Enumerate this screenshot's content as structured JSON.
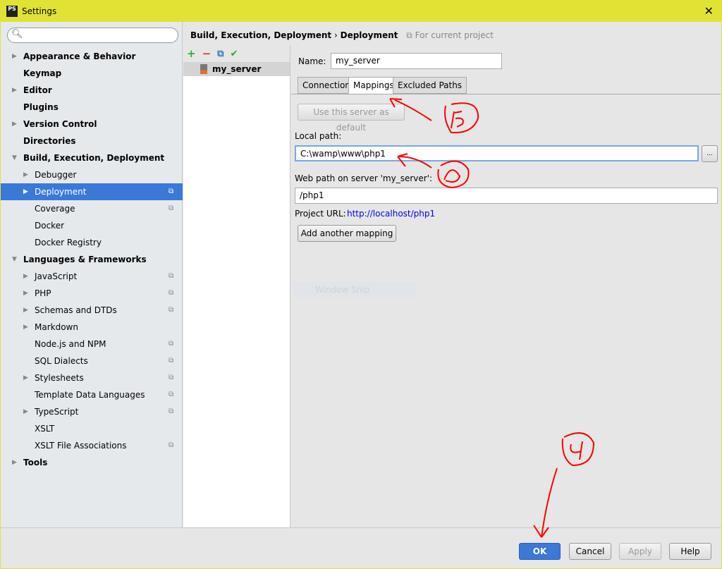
{
  "window": {
    "title": "Settings",
    "logo": "PS"
  },
  "search": {
    "placeholder": ""
  },
  "tree": [
    {
      "label": "Appearance & Behavior",
      "level": 0,
      "bold": true,
      "arrow": true
    },
    {
      "label": "Keymap",
      "level": 0,
      "bold": true,
      "arrow": false
    },
    {
      "label": "Editor",
      "level": 0,
      "bold": true,
      "arrow": true
    },
    {
      "label": "Plugins",
      "level": 0,
      "bold": true,
      "arrow": false
    },
    {
      "label": "Version Control",
      "level": 0,
      "bold": true,
      "arrow": true
    },
    {
      "label": "Directories",
      "level": 0,
      "bold": true,
      "arrow": false
    },
    {
      "label": "Build, Execution, Deployment",
      "level": 0,
      "bold": true,
      "arrow": "down"
    },
    {
      "label": "Debugger",
      "level": 1,
      "arrow": true
    },
    {
      "label": "Deployment",
      "level": 1,
      "arrow": true,
      "selected": true,
      "project": true
    },
    {
      "label": "Coverage",
      "level": 1,
      "project": true
    },
    {
      "label": "Docker",
      "level": 1
    },
    {
      "label": "Docker Registry",
      "level": 1
    },
    {
      "label": "Languages & Frameworks",
      "level": 0,
      "bold": true,
      "arrow": "down"
    },
    {
      "label": "JavaScript",
      "level": 1,
      "arrow": true,
      "project": true
    },
    {
      "label": "PHP",
      "level": 1,
      "arrow": true,
      "project": true
    },
    {
      "label": "Schemas and DTDs",
      "level": 1,
      "arrow": true,
      "project": true
    },
    {
      "label": "Markdown",
      "level": 1,
      "arrow": true
    },
    {
      "label": "Node.js and NPM",
      "level": 1,
      "project": true
    },
    {
      "label": "SQL Dialects",
      "level": 1,
      "project": true
    },
    {
      "label": "Stylesheets",
      "level": 1,
      "arrow": true,
      "project": true
    },
    {
      "label": "Template Data Languages",
      "level": 1,
      "project": true
    },
    {
      "label": "TypeScript",
      "level": 1,
      "arrow": true,
      "project": true
    },
    {
      "label": "XSLT",
      "level": 1
    },
    {
      "label": "XSLT File Associations",
      "level": 1,
      "project": true
    },
    {
      "label": "Tools",
      "level": 0,
      "bold": true,
      "arrow": true
    }
  ],
  "breadcrumb": {
    "parent": "Build, Execution, Deployment",
    "sep": "›",
    "current": "Deployment",
    "scope": "For current project"
  },
  "servers": [
    "my_server"
  ],
  "form": {
    "name_label": "Name:",
    "name_value": "my_server",
    "tabs": [
      "Connection",
      "Mappings",
      "Excluded Paths"
    ],
    "active_tab": "Mappings",
    "default_button": "Use this server as default",
    "local_path_label": "Local path:",
    "local_path_value": "C:\\wamp\\www\\php1",
    "browse": "...",
    "web_path_label": "Web path on server 'my_server':",
    "web_path_value": "/php1",
    "project_url_label": "Project URL:",
    "project_url": "http://localhost/php1",
    "add_mapping": "Add another mapping",
    "ghost": "Window Snip"
  },
  "footer": {
    "ok": "OK",
    "cancel": "Cancel",
    "apply": "Apply",
    "help": "Help"
  },
  "colors": {
    "titlebar": "#e1e334",
    "selection": "#3b78d8",
    "ok": "#3b78d8",
    "annotation": "#ff0000",
    "link": "#0000ee"
  }
}
